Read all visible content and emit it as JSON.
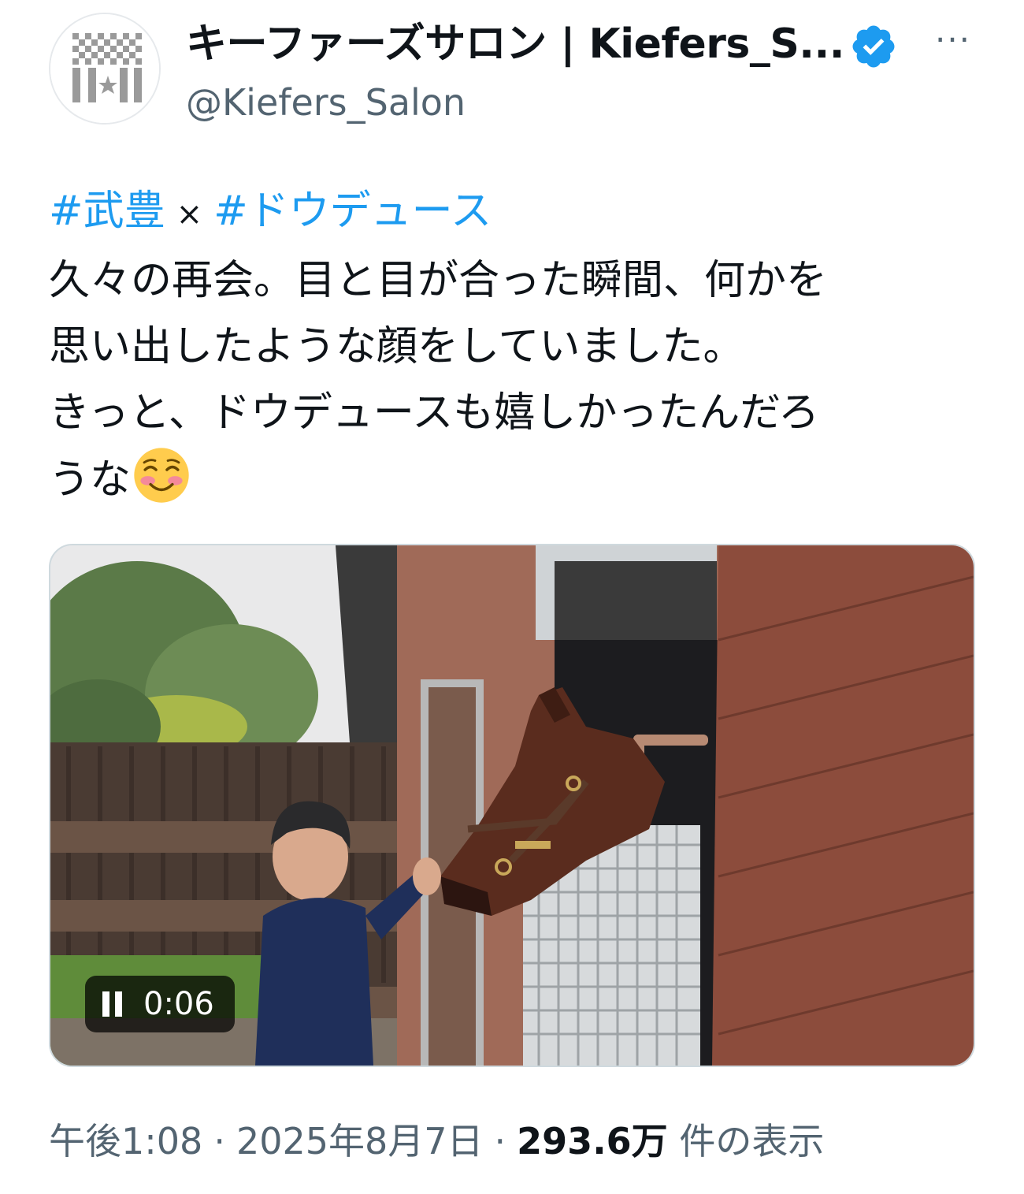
{
  "account": {
    "display_name": "キーファーズサロン | Kiefers_S...",
    "handle": "@Kiefers_Salon",
    "verified": true,
    "verified_badge_color": "#1d9bf0",
    "more_icon": "more-horizontal-icon",
    "more_label": "···"
  },
  "tweet": {
    "hashtag_1": "#武豊",
    "connector": "×",
    "hashtag_2": "#ドウデュース",
    "line_1": "久々の再会。目と目が合った瞬間、何かを",
    "line_2": "思い出したような顔をしていました。",
    "line_3": "きっと、ドウデュースも嬉しかったんだろ",
    "line_4": "うな",
    "emoji": "smiling-face-with-blush-icon"
  },
  "media": {
    "type": "video",
    "time": "0:06",
    "control_icon": "pause-icon"
  },
  "footer": {
    "time": "午後1:08",
    "separator": "·",
    "date": "2025年8月7日",
    "views": "293.6万",
    "views_suffix": "件の表示"
  },
  "colors": {
    "link": "#1d9bf0",
    "text": "#0f1419",
    "secondary": "#536471"
  }
}
